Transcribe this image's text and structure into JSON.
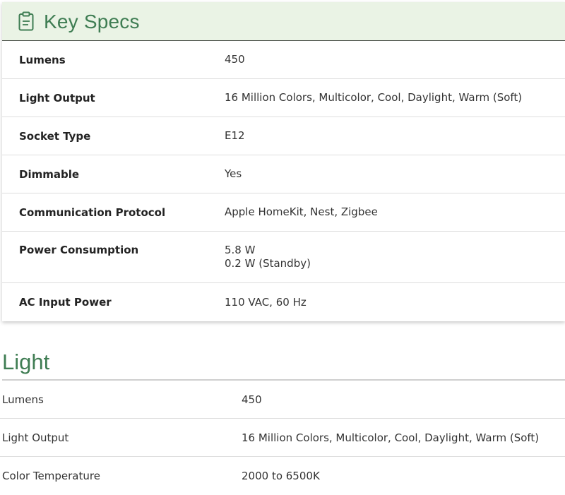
{
  "key_specs": {
    "title": "Key Specs",
    "icon": "clipboard-icon",
    "accent_color": "#3f7d53",
    "header_bg": "#eaf3e5",
    "rows": [
      {
        "label": "Lumens",
        "values": [
          "450"
        ]
      },
      {
        "label": "Light Output",
        "values": [
          "16 Million Colors, Multicolor, Cool, Daylight, Warm (Soft)"
        ]
      },
      {
        "label": "Socket Type",
        "values": [
          "E12"
        ]
      },
      {
        "label": "Dimmable",
        "values": [
          "Yes"
        ]
      },
      {
        "label": "Communication Protocol",
        "values": [
          "Apple HomeKit, Nest, Zigbee"
        ]
      },
      {
        "label": "Power Consumption",
        "values": [
          "5.8 W",
          "0.2 W (Standby)"
        ]
      },
      {
        "label": "AC Input Power",
        "values": [
          "110 VAC, 60 Hz"
        ]
      }
    ]
  },
  "light": {
    "title": "Light",
    "rows": [
      {
        "label": "Lumens",
        "value": "450"
      },
      {
        "label": "Light Output",
        "value": "16 Million Colors, Multicolor, Cool, Daylight, Warm (Soft)"
      },
      {
        "label": "Color Temperature",
        "value": "2000 to 6500K"
      }
    ]
  }
}
